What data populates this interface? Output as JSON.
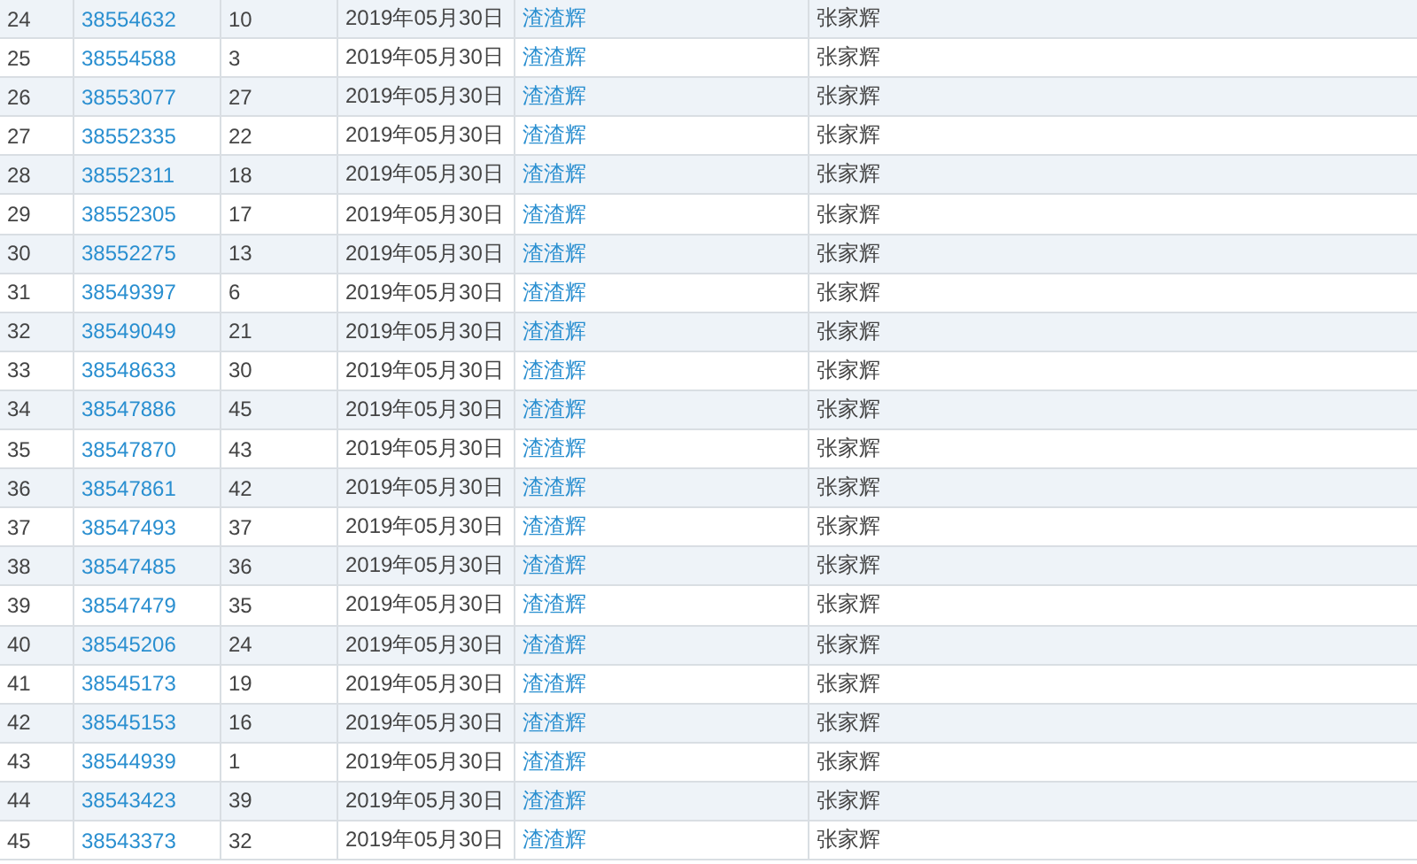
{
  "table": {
    "rows": [
      {
        "number": "24",
        "id": "38554632",
        "count": "10",
        "date": "2019年05月30日",
        "author": "渣渣辉",
        "owner": "张家辉"
      },
      {
        "number": "25",
        "id": "38554588",
        "count": "3",
        "date": "2019年05月30日",
        "author": "渣渣辉",
        "owner": "张家辉"
      },
      {
        "number": "26",
        "id": "38553077",
        "count": "27",
        "date": "2019年05月30日",
        "author": "渣渣辉",
        "owner": "张家辉"
      },
      {
        "number": "27",
        "id": "38552335",
        "count": "22",
        "date": "2019年05月30日",
        "author": "渣渣辉",
        "owner": "张家辉"
      },
      {
        "number": "28",
        "id": "38552311",
        "count": "18",
        "date": "2019年05月30日",
        "author": "渣渣辉",
        "owner": "张家辉"
      },
      {
        "number": "29",
        "id": "38552305",
        "count": "17",
        "date": "2019年05月30日",
        "author": "渣渣辉",
        "owner": "张家辉"
      },
      {
        "number": "30",
        "id": "38552275",
        "count": "13",
        "date": "2019年05月30日",
        "author": "渣渣辉",
        "owner": "张家辉"
      },
      {
        "number": "31",
        "id": "38549397",
        "count": "6",
        "date": "2019年05月30日",
        "author": "渣渣辉",
        "owner": "张家辉"
      },
      {
        "number": "32",
        "id": "38549049",
        "count": "21",
        "date": "2019年05月30日",
        "author": "渣渣辉",
        "owner": "张家辉"
      },
      {
        "number": "33",
        "id": "38548633",
        "count": "30",
        "date": "2019年05月30日",
        "author": "渣渣辉",
        "owner": "张家辉"
      },
      {
        "number": "34",
        "id": "38547886",
        "count": "45",
        "date": "2019年05月30日",
        "author": "渣渣辉",
        "owner": "张家辉"
      },
      {
        "number": "35",
        "id": "38547870",
        "count": "43",
        "date": "2019年05月30日",
        "author": "渣渣辉",
        "owner": "张家辉"
      },
      {
        "number": "36",
        "id": "38547861",
        "count": "42",
        "date": "2019年05月30日",
        "author": "渣渣辉",
        "owner": "张家辉"
      },
      {
        "number": "37",
        "id": "38547493",
        "count": "37",
        "date": "2019年05月30日",
        "author": "渣渣辉",
        "owner": "张家辉"
      },
      {
        "number": "38",
        "id": "38547485",
        "count": "36",
        "date": "2019年05月30日",
        "author": "渣渣辉",
        "owner": "张家辉"
      },
      {
        "number": "39",
        "id": "38547479",
        "count": "35",
        "date": "2019年05月30日",
        "author": "渣渣辉",
        "owner": "张家辉"
      },
      {
        "number": "40",
        "id": "38545206",
        "count": "24",
        "date": "2019年05月30日",
        "author": "渣渣辉",
        "owner": "张家辉"
      },
      {
        "number": "41",
        "id": "38545173",
        "count": "19",
        "date": "2019年05月30日",
        "author": "渣渣辉",
        "owner": "张家辉"
      },
      {
        "number": "42",
        "id": "38545153",
        "count": "16",
        "date": "2019年05月30日",
        "author": "渣渣辉",
        "owner": "张家辉"
      },
      {
        "number": "43",
        "id": "38544939",
        "count": "1",
        "date": "2019年05月30日",
        "author": "渣渣辉",
        "owner": "张家辉"
      },
      {
        "number": "44",
        "id": "38543423",
        "count": "39",
        "date": "2019年05月30日",
        "author": "渣渣辉",
        "owner": "张家辉"
      },
      {
        "number": "45",
        "id": "38543373",
        "count": "32",
        "date": "2019年05月30日",
        "author": "渣渣辉",
        "owner": "张家辉"
      }
    ]
  }
}
